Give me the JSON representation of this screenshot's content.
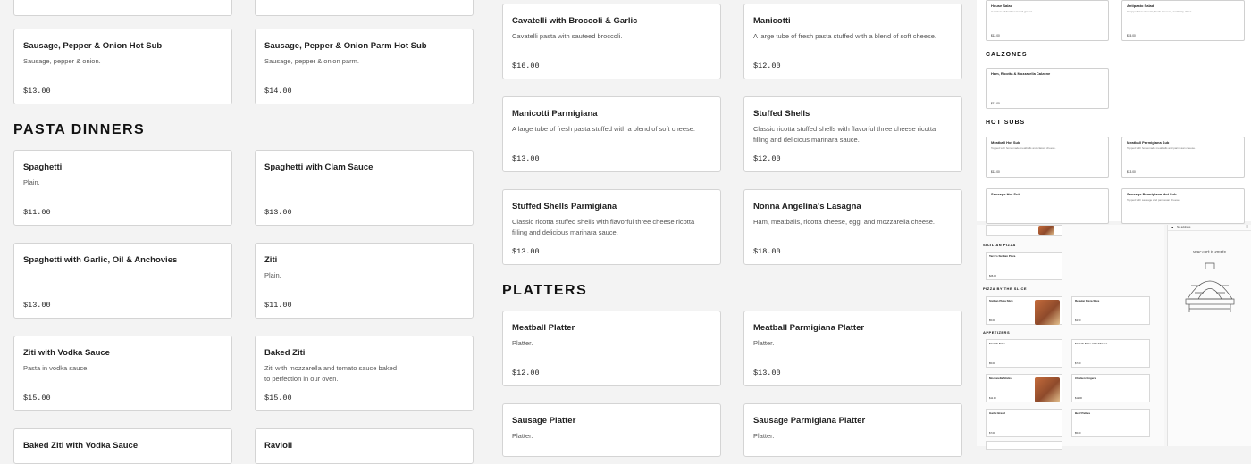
{
  "col1": {
    "top_items": [
      {
        "name": "Sausage, Pepper & Onion Hot Sub",
        "desc": "Sausage, pepper & onion.",
        "price": "$13.00"
      }
    ],
    "pasta_header": "PASTA DINNERS",
    "pasta_items": [
      {
        "name": "Spaghetti",
        "desc": "Plain.",
        "price": "$11.00"
      },
      {
        "name": "Spaghetti with Garlic, Oil & Anchovies",
        "desc": "",
        "price": "$13.00"
      },
      {
        "name": "Ziti with Vodka Sauce",
        "desc": "Pasta in vodka sauce.",
        "price": "$15.00"
      },
      {
        "name": "Baked Ziti with Vodka Sauce",
        "desc": "",
        "price": ""
      }
    ]
  },
  "col2": {
    "top_items": [
      {
        "name": "Sausage, Pepper & Onion Parm Hot Sub",
        "desc": "Sausage, pepper & onion parm.",
        "price": "$14.00"
      }
    ],
    "pasta_items": [
      {
        "name": "Spaghetti with Clam Sauce",
        "desc": "",
        "price": "$13.00"
      },
      {
        "name": "Ziti",
        "desc": "Plain.",
        "price": "$11.00"
      },
      {
        "name": "Baked Ziti",
        "desc": "Ziti with mozzarella and tomato sauce baked to perfection in our oven.",
        "price": "$15.00"
      },
      {
        "name": "Ravioli",
        "desc": "",
        "price": ""
      }
    ]
  },
  "col3": {
    "items": [
      {
        "name": "Cavatelli with Broccoli & Garlic",
        "desc": "Cavatelli pasta with sauteed broccoli.",
        "price": "$16.00"
      },
      {
        "name": "Manicotti Parmigiana",
        "desc": "A large tube of fresh pasta stuffed with a blend of soft cheese.",
        "price": "$13.00"
      },
      {
        "name": "Stuffed Shells Parmigiana",
        "desc": "Classic ricotta stuffed shells with flavorful three cheese ricotta filling and delicious marinara sauce.",
        "price": "$13.00"
      }
    ],
    "platters_header": "PLATTERS",
    "platters": [
      {
        "name": "Meatball Platter",
        "desc": "Platter.",
        "price": "$12.00"
      },
      {
        "name": "Sausage Platter",
        "desc": "Platter.",
        "price": ""
      }
    ]
  },
  "col4": {
    "items": [
      {
        "name": "Manicotti",
        "desc": "A large tube of fresh pasta stuffed with a blend of soft cheese.",
        "price": "$12.00"
      },
      {
        "name": "Stuffed Shells",
        "desc": "Classic ricotta stuffed shells with flavorful three cheese ricotta filling and delicious marinara sauce.",
        "price": "$12.00"
      },
      {
        "name": "Nonna Angelina's Lasagna",
        "desc": "Ham, meatballs, ricotta cheese, egg, and mozzarella cheese.",
        "price": "$18.00"
      }
    ],
    "platters": [
      {
        "name": "Meatball Parmigiana Platter",
        "desc": "Platter.",
        "price": "$13.00"
      },
      {
        "name": "Sausage Parmigiana Platter",
        "desc": "Platter.",
        "price": ""
      }
    ]
  },
  "preview_top": {
    "salads": [
      {
        "name": "House Salad",
        "desc": "A mixture of fresh seasonal greens.",
        "price": "$12.00"
      },
      {
        "name": "Antipasto Salad",
        "desc": "Chopped cured meats, fresh cheeses, and briny olives.",
        "price": "$15.00"
      }
    ],
    "calzones_header": "CALZONES",
    "calzones": [
      {
        "name": "Ham, Ricotta & Mozzarella Calzone",
        "price": "$13.00"
      }
    ],
    "hot_subs_header": "HOT SUBS",
    "hot_subs": [
      {
        "name": "Meatball Hot Sub",
        "desc": "Topped with homemade meatballs and classic cheese.",
        "price": "$12.00"
      },
      {
        "name": "Meatball Parmigiana Sub",
        "desc": "Topped with homemade meatballs and parmesan cheese.",
        "price": "$13.00"
      },
      {
        "name": "Sausage Hot Sub",
        "desc": "",
        "price": ""
      },
      {
        "name": "Sausage Parmigiana Hot Sub",
        "desc": "Topped with sausage and parmesan cheese.",
        "price": ""
      }
    ]
  },
  "preview_bottom": {
    "sicilian_header": "SICILIAN PIZZA",
    "sicilian": [
      {
        "name": "Tarra's Sicilian Pizza",
        "price": "$26.00"
      }
    ],
    "slice_header": "PIZZA BY THE SLICE",
    "slices": [
      {
        "name": "Sicilian Pizza Slice",
        "price": "$5.00"
      },
      {
        "name": "Regular Pizza Slice",
        "price": "$3.50"
      }
    ],
    "apps_header": "APPETIZERS",
    "apps": [
      {
        "name": "French Fries",
        "price": "$5.00"
      },
      {
        "name": "French Fries with Cheese",
        "price": "$7.00"
      },
      {
        "name": "Mozzarella Sticks",
        "price": "$11.00"
      },
      {
        "name": "Chicken Fingers",
        "price": "$12.00"
      },
      {
        "name": "Garlic Bread",
        "price": "$7.00"
      },
      {
        "name": "Beef Patties",
        "price": "$5.00"
      }
    ],
    "delivery_label": "No address",
    "tagline": "your cart is empty"
  }
}
